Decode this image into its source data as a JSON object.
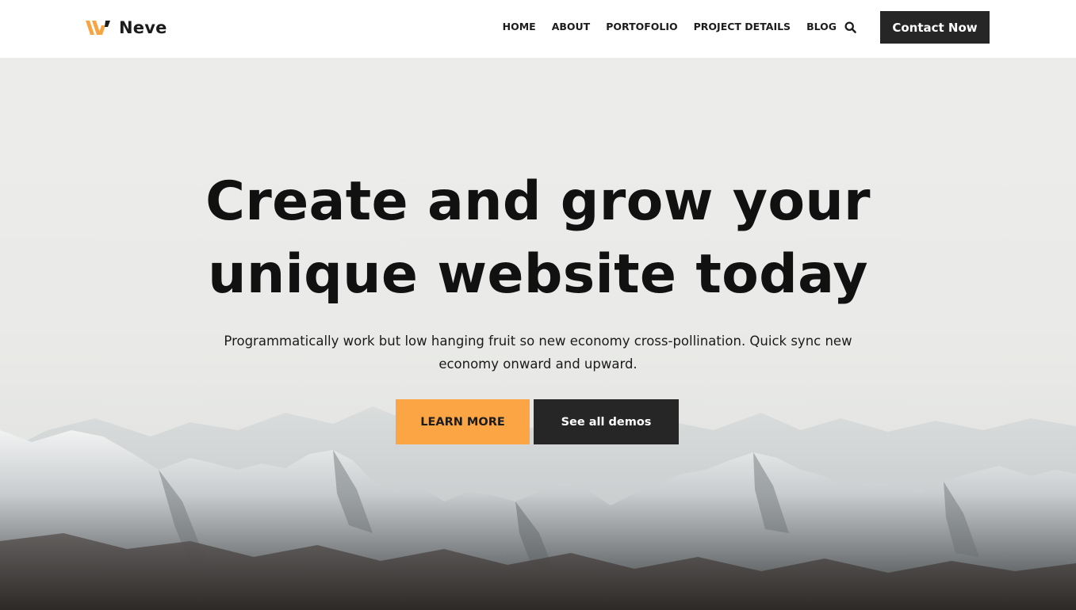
{
  "header": {
    "logo_text": "Neve",
    "nav": [
      {
        "label": "HOME"
      },
      {
        "label": "ABOUT"
      },
      {
        "label": "PORTOFOLIO"
      },
      {
        "label": "PROJECT DETAILS"
      },
      {
        "label": "BLOG"
      }
    ],
    "search_icon": "search-icon",
    "cta_label": "Contact Now"
  },
  "hero": {
    "title_line1": "Create and grow your",
    "title_line2": "unique website today",
    "subtitle": "Programmatically work but low hanging fruit so new economy cross-pollination. Quick sync new economy onward and upward.",
    "primary_button": "LEARN MORE",
    "secondary_button": "See all demos",
    "background_image": "snow-capped mountain range under hazy sky"
  },
  "colors": {
    "accent": "#fba544",
    "dark": "#262626",
    "text": "#1c1c1c"
  }
}
